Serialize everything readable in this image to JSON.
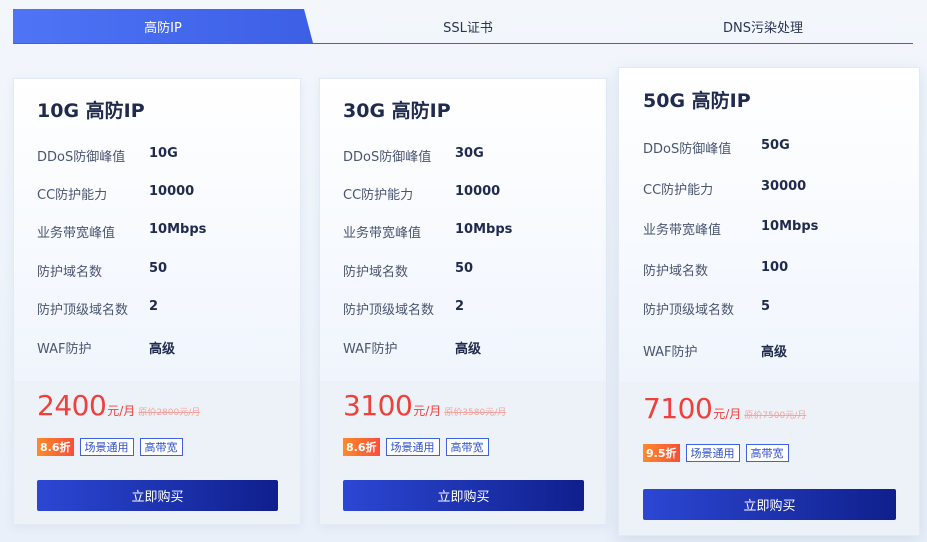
{
  "tabs": [
    {
      "label": "高防IP",
      "active": true
    },
    {
      "label": "SSL证书",
      "active": false
    },
    {
      "label": "DNS污染处理",
      "active": false
    }
  ],
  "colors": {
    "accent": "#3c5fe6",
    "price": "#f0403a",
    "button_start": "#2c47d4",
    "button_end": "#0f1f8c"
  },
  "cards": [
    {
      "title": "10G 高防IP",
      "specs": [
        {
          "label": "DDoS防御峰值",
          "value": "10G"
        },
        {
          "label": "CC防护能力",
          "value": "10000"
        },
        {
          "label": "业务带宽峰值",
          "value": "10Mbps"
        },
        {
          "label": "防护域名数",
          "value": "50"
        },
        {
          "label": "防护顶级域名数",
          "value": "2"
        },
        {
          "label": "WAF防护",
          "value": "高级"
        }
      ],
      "price": "2400",
      "unit": "元/月",
      "original_price": "原价2800元/月",
      "discount": "8.6折",
      "tags": [
        "场景通用",
        "高带宽"
      ],
      "button": "立即购买"
    },
    {
      "title": "30G 高防IP",
      "specs": [
        {
          "label": "DDoS防御峰值",
          "value": "30G"
        },
        {
          "label": "CC防护能力",
          "value": "10000"
        },
        {
          "label": "业务带宽峰值",
          "value": "10Mbps"
        },
        {
          "label": "防护域名数",
          "value": "50"
        },
        {
          "label": "防护顶级域名数",
          "value": "2"
        },
        {
          "label": "WAF防护",
          "value": "高级"
        }
      ],
      "price": "3100",
      "unit": "元/月",
      "original_price": "原价3580元/月",
      "discount": "8.6折",
      "tags": [
        "场景通用",
        "高带宽"
      ],
      "button": "立即购买"
    },
    {
      "title": "50G 高防IP",
      "specs": [
        {
          "label": "DDoS防御峰值",
          "value": "50G"
        },
        {
          "label": "CC防护能力",
          "value": "30000"
        },
        {
          "label": "业务带宽峰值",
          "value": "10Mbps"
        },
        {
          "label": "防护域名数",
          "value": "100"
        },
        {
          "label": "防护顶级域名数",
          "value": "5"
        },
        {
          "label": "WAF防护",
          "value": "高级"
        }
      ],
      "price": "7100",
      "unit": "元/月",
      "original_price": "原价7500元/月",
      "discount": "9.5折",
      "tags": [
        "场景通用",
        "高带宽"
      ],
      "button": "立即购买"
    }
  ]
}
